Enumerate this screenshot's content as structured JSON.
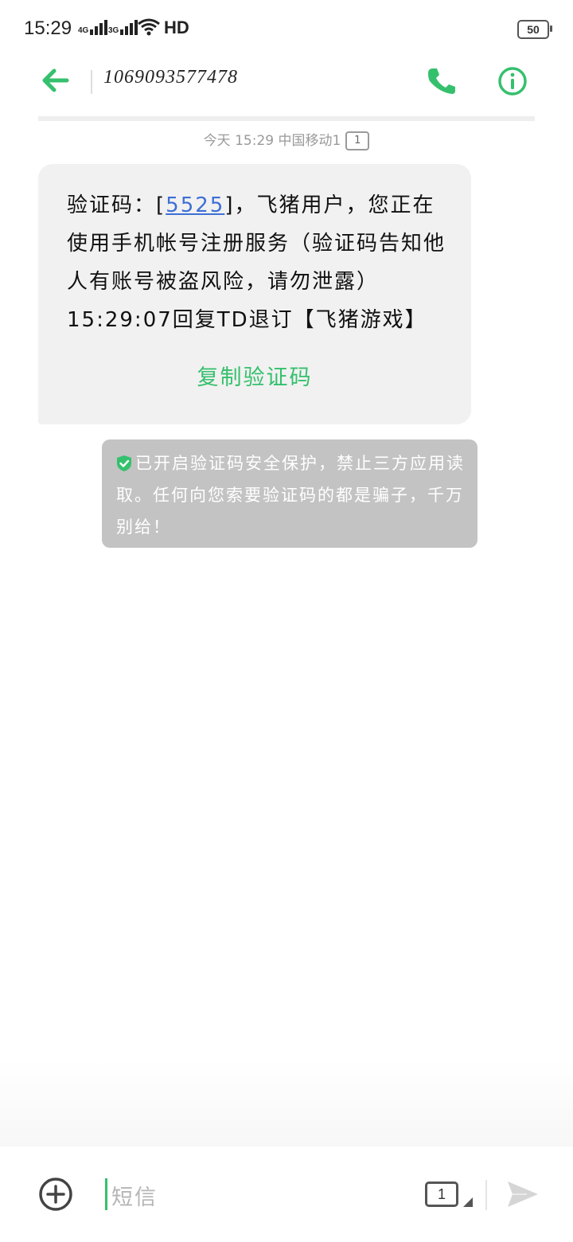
{
  "status_bar": {
    "time": "15:29",
    "network1": "4G",
    "network2": "3G",
    "hd": "HD",
    "battery": "50"
  },
  "header": {
    "contact": "1069093577478",
    "back_icon": "arrow-left-icon",
    "call_icon": "phone-icon",
    "info_icon": "info-icon",
    "accent_color": "#35c06d"
  },
  "message": {
    "meta": "今天 15:29 中国移动1",
    "sim": "1",
    "text_before": "验证码：[",
    "code": "5525",
    "text_after": "]，飞猪用户，您正在使用手机帐号注册服务（验证码告知他人有账号被盗风险，请勿泄露）15:29:07回复TD退订【飞猪游戏】",
    "copy_label": "复制验证码"
  },
  "notice": {
    "text": "已开启验证码安全保护，禁止三方应用读取。任何向您索要验证码的都是骗子，千万别给！",
    "icon": "shield-check-icon"
  },
  "composer": {
    "placeholder": "短信",
    "sim": "1",
    "add_icon": "plus-circle-icon",
    "send_icon": "send-icon"
  }
}
